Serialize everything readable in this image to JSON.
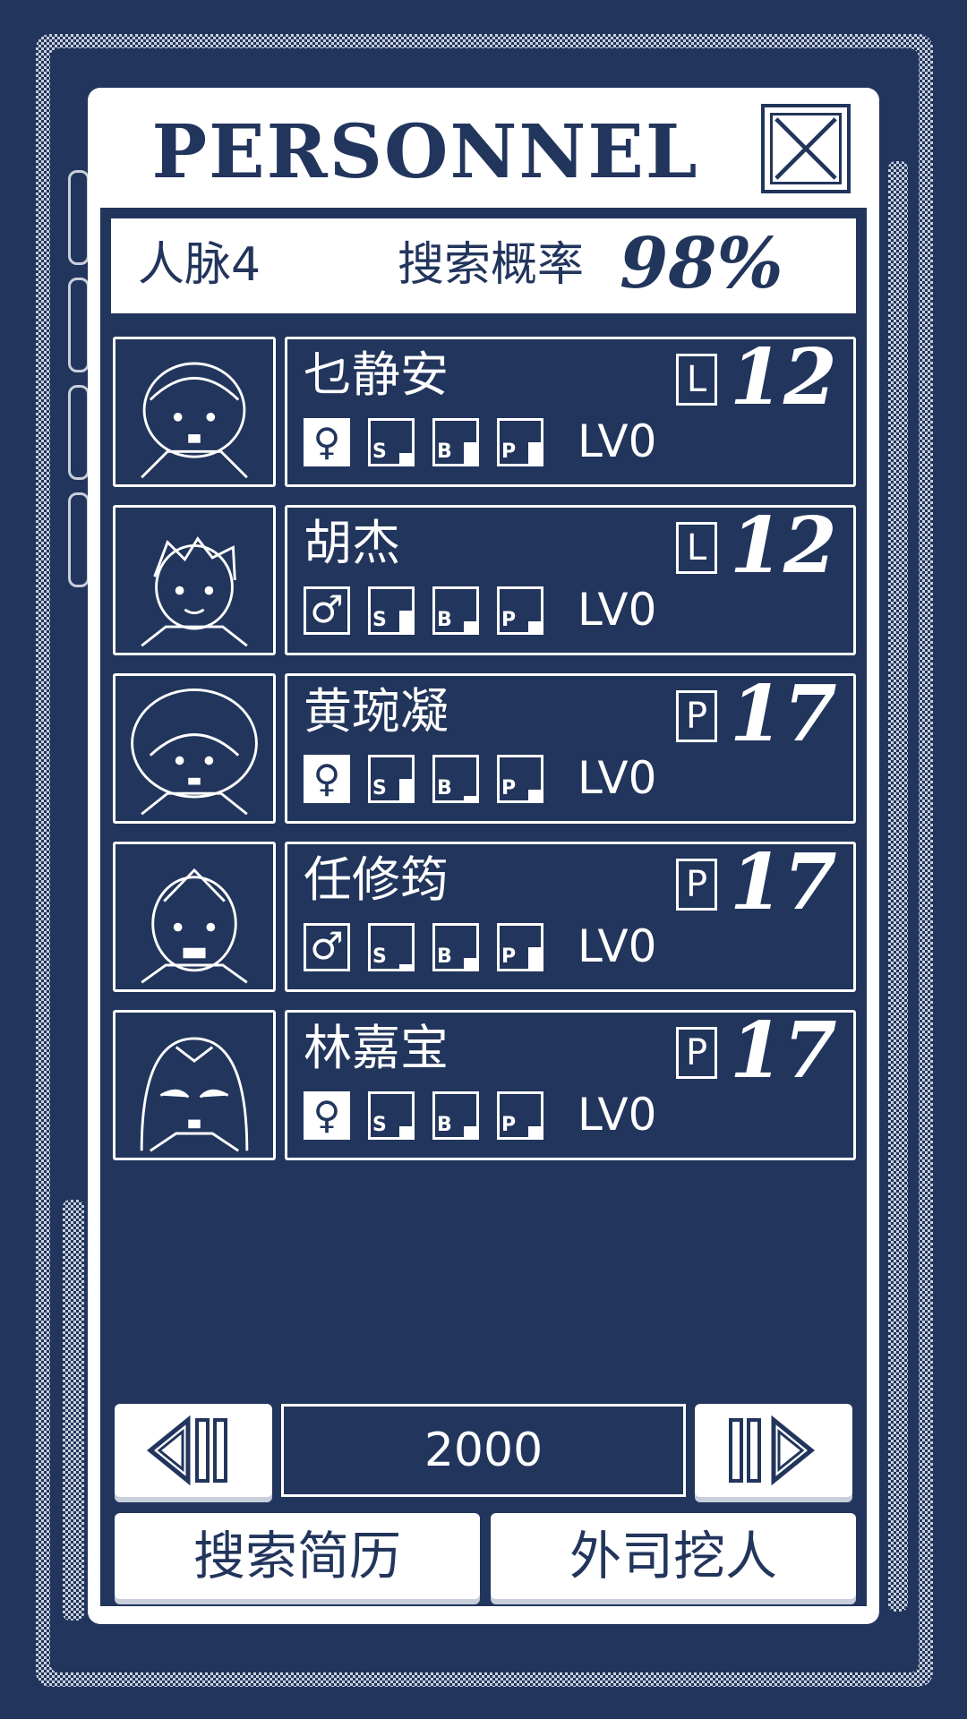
{
  "header": {
    "title": "PERSONNEL"
  },
  "info": {
    "contacts": "人脉4",
    "search_rate_label": "搜索概率",
    "search_rate_value": "98%"
  },
  "candidates": [
    {
      "name": "乜静安",
      "role": "L",
      "number": "12",
      "gender": "female",
      "gender_glyph": "♀",
      "stats": [
        {
          "letter": "S",
          "level": 0.25
        },
        {
          "letter": "B",
          "level": 0.5
        },
        {
          "letter": "P",
          "level": 0.5
        }
      ],
      "level": "LV0"
    },
    {
      "name": "胡杰",
      "role": "L",
      "number": "12",
      "gender": "male",
      "gender_glyph": "♂",
      "stats": [
        {
          "letter": "S",
          "level": 0.5
        },
        {
          "letter": "B",
          "level": 0.25
        },
        {
          "letter": "P",
          "level": 0.25
        }
      ],
      "level": "LV0"
    },
    {
      "name": "黄琬凝",
      "role": "P",
      "number": "17",
      "gender": "female",
      "gender_glyph": "♀",
      "stats": [
        {
          "letter": "S",
          "level": 0.5
        },
        {
          "letter": "B",
          "level": 0.1
        },
        {
          "letter": "P",
          "level": 0.25
        }
      ],
      "level": "LV0"
    },
    {
      "name": "任修筠",
      "role": "P",
      "number": "17",
      "gender": "male",
      "gender_glyph": "♂",
      "stats": [
        {
          "letter": "S",
          "level": 0.1
        },
        {
          "letter": "B",
          "level": 0.25
        },
        {
          "letter": "P",
          "level": 0.5
        }
      ],
      "level": "LV0"
    },
    {
      "name": "林嘉宝",
      "role": "P",
      "number": "17",
      "gender": "female",
      "gender_glyph": "♀",
      "stats": [
        {
          "letter": "S",
          "level": 0.25
        },
        {
          "letter": "B",
          "level": 0.25
        },
        {
          "letter": "P",
          "level": 0.25
        }
      ],
      "level": "LV0"
    }
  ],
  "year": "2000",
  "actions": {
    "search_resume": "搜索简历",
    "poach": "外司挖人"
  },
  "colors": {
    "navy": "#22355c",
    "white": "#ffffff",
    "dither": "#c8cfdb"
  }
}
